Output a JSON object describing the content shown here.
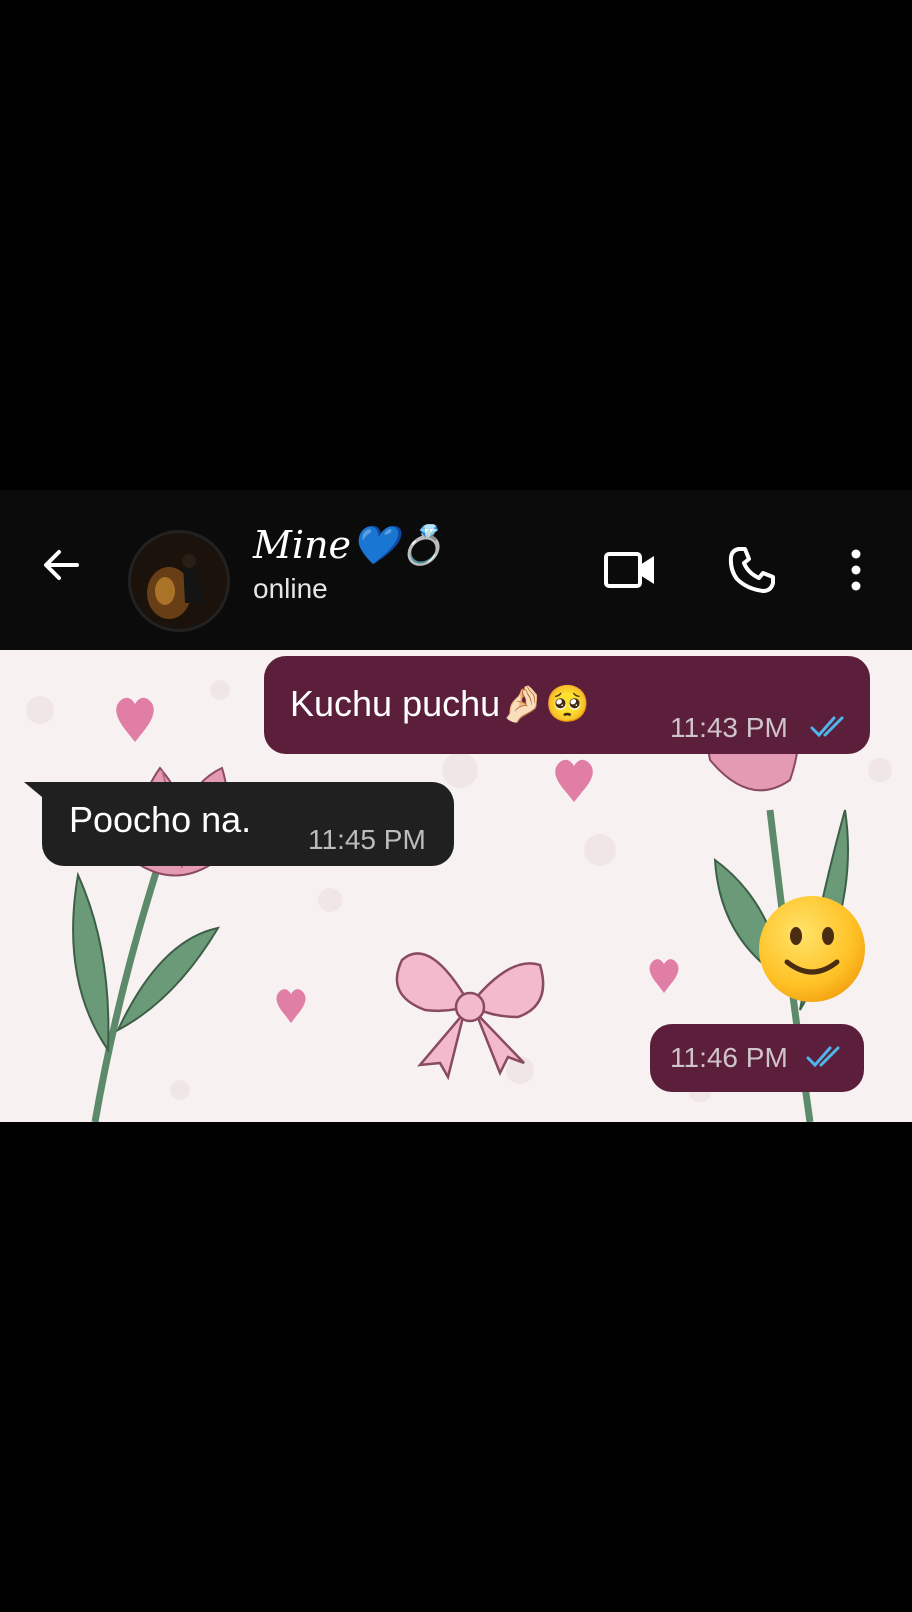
{
  "header": {
    "contact_name": "Mine💙💍",
    "status": "online",
    "icons": {
      "back": "arrow-left-icon",
      "video": "video-camera-icon",
      "call": "phone-icon",
      "menu": "more-vertical-icon"
    }
  },
  "messages": [
    {
      "direction": "outgoing",
      "text": "Kuchu puchu🤌🏻🥺",
      "time": "11:43 PM",
      "status": "read"
    },
    {
      "direction": "incoming",
      "text": "Poocho na.",
      "time": "11:45 PM"
    },
    {
      "direction": "outgoing",
      "text": "🙂",
      "time": "11:46 PM",
      "status": "read",
      "type": "large-emoji"
    }
  ],
  "colors": {
    "header_bg": "#0b0b0b",
    "chat_bg": "#f7f2f1",
    "outgoing_bubble": "#5b1f3b",
    "incoming_bubble": "#202020",
    "read_ticks": "#4fb6ec"
  }
}
